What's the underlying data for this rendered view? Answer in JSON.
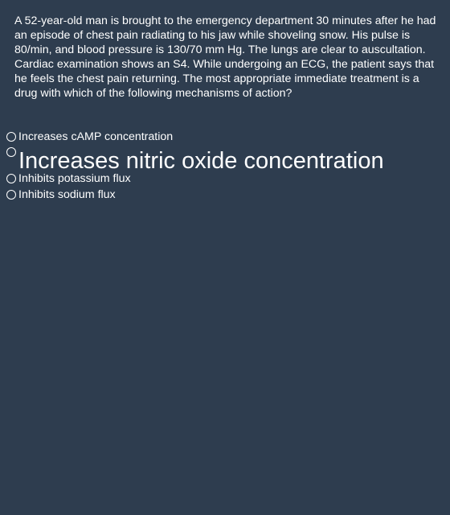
{
  "question": {
    "text": "A 52-year-old man is brought to the emergency department 30 minutes after he had an episode of chest pain radiating to his jaw while shoveling snow. His pulse is 80/min, and blood pressure is 130/70 mm Hg. The lungs are clear to auscultation. Cardiac examination shows an S4. While undergoing an ECG, the patient says that he feels the chest pain returning. The most appropriate immediate treatment is a drug with which of the following mechanisms of action?"
  },
  "options": [
    {
      "label": "Increases cAMP concentration"
    },
    {
      "label": "Increases nitric oxide concentration"
    },
    {
      "label": "Inhibits potassium flux"
    },
    {
      "label": "Inhibits sodium flux"
    }
  ],
  "colors": {
    "background": "#2e3d4f",
    "text": "#ffffff"
  }
}
